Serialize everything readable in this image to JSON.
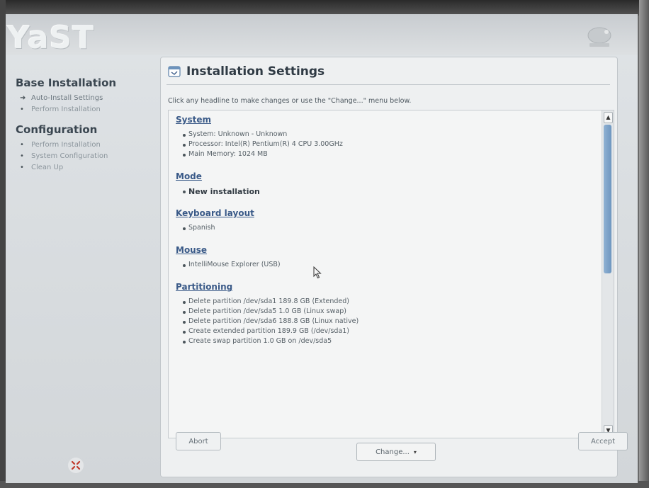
{
  "brand": {
    "app_logo_text": "YaST"
  },
  "sidebar": {
    "sections": [
      {
        "title": "Base Installation",
        "items": [
          {
            "label": "Auto-Install Settings",
            "state": "current"
          },
          {
            "label": "Perform Installation",
            "state": "pending"
          }
        ]
      },
      {
        "title": "Configuration",
        "items": [
          {
            "label": "Perform Installation",
            "state": "pending"
          },
          {
            "label": "System Configuration",
            "state": "pending"
          },
          {
            "label": "Clean Up",
            "state": "pending"
          }
        ]
      }
    ]
  },
  "panel": {
    "title": "Installation Settings",
    "hint": "Click any headline to make changes or use the \"Change...\" menu below.",
    "sections": [
      {
        "heading": "System",
        "items": [
          {
            "text": "System: Unknown - Unknown"
          },
          {
            "text": "Processor: Intel(R) Pentium(R) 4 CPU 3.00GHz"
          },
          {
            "text": "Main Memory: 1024 MB"
          }
        ]
      },
      {
        "heading": "Mode",
        "items": [
          {
            "text": "New installation",
            "bold": true
          }
        ]
      },
      {
        "heading": "Keyboard layout",
        "items": [
          {
            "text": "Spanish"
          }
        ]
      },
      {
        "heading": "Mouse",
        "items": [
          {
            "text": "IntelliMouse Explorer (USB)"
          }
        ]
      },
      {
        "heading": "Partitioning",
        "items": [
          {
            "text": "Delete partition /dev/sda1 189.8 GB (Extended)"
          },
          {
            "text": "Delete partition /dev/sda5 1.0 GB (Linux swap)"
          },
          {
            "text": "Delete partition /dev/sda6 188.8 GB (Linux native)"
          },
          {
            "text": "Create extended partition 189.9 GB (/dev/sda1)"
          },
          {
            "text": "Create swap partition 1.0 GB on /dev/sda5"
          }
        ]
      }
    ],
    "change_button": "Change...",
    "change_arrow": "▾"
  },
  "footer": {
    "abort_label": "Abort",
    "accept_label": "Accept"
  },
  "scrollbar": {
    "up_glyph": "▲",
    "down_glyph": "▼"
  },
  "colors": {
    "accent": "#3a5a88",
    "scroll_thumb": "#7a9fc6"
  }
}
